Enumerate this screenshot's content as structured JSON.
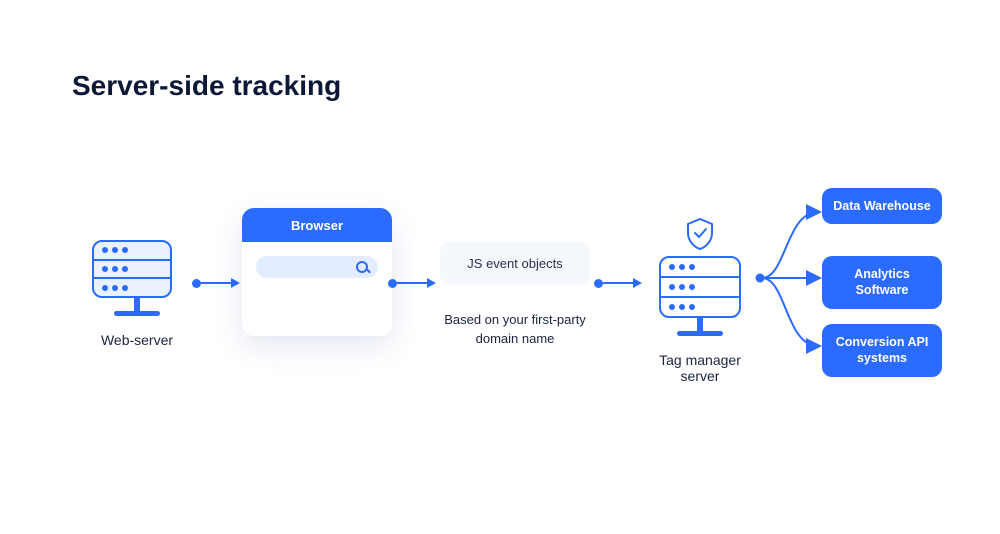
{
  "title": "Server-side tracking",
  "nodes": {
    "webserver_label": "Web-server",
    "browser_title": "Browser",
    "js_event_label": "JS event objects",
    "js_event_sublabel": "Based on your first-party domain name",
    "tag_manager_label": "Tag manager server"
  },
  "destinations": [
    "Data Warehouse",
    "Analytics Software",
    "Conversion API systems"
  ],
  "colors": {
    "accent": "#2b6bff",
    "title": "#0d1836"
  }
}
